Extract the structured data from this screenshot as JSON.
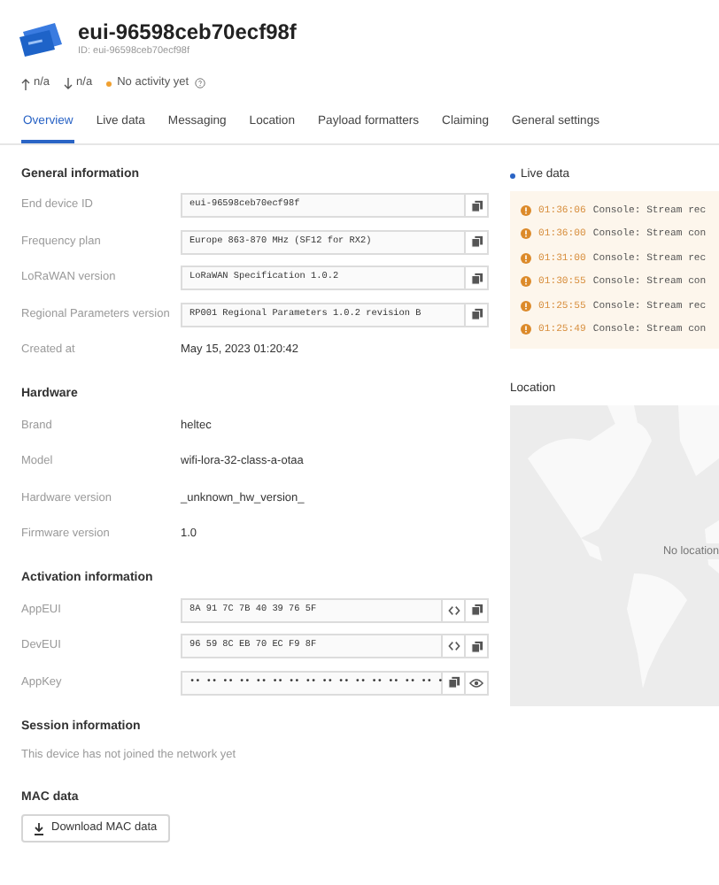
{
  "header": {
    "title": "eui-96598ceb70ecf98f",
    "id_line": "ID: eui-96598ceb70ecf98f"
  },
  "stats": {
    "uplink": "n/a",
    "downlink": "n/a",
    "activity": "No activity yet"
  },
  "tabs": [
    {
      "label": "Overview",
      "selected": true
    },
    {
      "label": "Live data",
      "selected": false
    },
    {
      "label": "Messaging",
      "selected": false
    },
    {
      "label": "Location",
      "selected": false
    },
    {
      "label": "Payload formatters",
      "selected": false
    },
    {
      "label": "Claiming",
      "selected": false
    },
    {
      "label": "General settings",
      "selected": false
    }
  ],
  "sections": [
    {
      "title": "General information",
      "rows": [
        {
          "label": "End device ID",
          "kind": "field",
          "value": "eui-96598ceb70ecf98f",
          "buttons": [
            {
              "kind": "copy"
            }
          ]
        },
        {
          "label": "Frequency plan",
          "kind": "field",
          "value": "Europe 863-870 MHz (SF12 for RX2)",
          "buttons": [
            {
              "kind": "copy"
            }
          ]
        },
        {
          "label": "LoRaWAN version",
          "kind": "field",
          "value": "LoRaWAN Specification 1.0.2",
          "buttons": [
            {
              "kind": "copy"
            }
          ]
        },
        {
          "label": "Regional Parameters version",
          "kind": "field",
          "value": "RP001 Regional Parameters 1.0.2 revision B",
          "buttons": [
            {
              "kind": "copy"
            }
          ]
        },
        {
          "label": "Created at",
          "kind": "text",
          "value": "May 15, 2023 01:20:42"
        }
      ]
    },
    {
      "title": "Hardware",
      "rows": [
        {
          "label": "Brand",
          "kind": "text",
          "value": "heltec"
        },
        {
          "label": "Model",
          "kind": "text",
          "value": "wifi-lora-32-class-a-otaa"
        },
        {
          "label": "Hardware version",
          "kind": "text",
          "value": "_unknown_hw_version_"
        },
        {
          "label": "Firmware version",
          "kind": "text",
          "value": "1.0"
        }
      ]
    },
    {
      "title": "Activation information",
      "rows": [
        {
          "label": "AppEUI",
          "kind": "field",
          "value": "8A 91 7C 7B 40 39 76 5F",
          "buttons": [
            {
              "kind": "code"
            },
            {
              "kind": "copy"
            }
          ]
        },
        {
          "label": "DevEUI",
          "kind": "field",
          "value": "96 59 8C EB 70 EC F9 8F",
          "buttons": [
            {
              "kind": "code"
            },
            {
              "kind": "copy"
            }
          ]
        },
        {
          "label": "AppKey",
          "kind": "field",
          "value": "•• •• •• •• •• •• •• •• •• •• •• •• •• •• •• ••",
          "buttons": [
            {
              "kind": "copy"
            },
            {
              "kind": "eye"
            }
          ]
        }
      ]
    },
    {
      "title": "Session information",
      "note": "This device has not joined the network yet"
    },
    {
      "title": "MAC data",
      "button": "Download MAC data"
    }
  ],
  "live_data": {
    "title": "Live data",
    "events": [
      {
        "time": "01:36:06",
        "message": "Console: Stream rec"
      },
      {
        "time": "01:36:00",
        "message": "Console: Stream con"
      },
      {
        "time": "01:31:00",
        "message": "Console: Stream rec"
      },
      {
        "time": "01:30:55",
        "message": "Console: Stream con"
      },
      {
        "time": "01:25:55",
        "message": "Console: Stream rec"
      },
      {
        "time": "01:25:49",
        "message": "Console: Stream con"
      }
    ]
  },
  "location": {
    "title": "Location",
    "note": "No location"
  }
}
